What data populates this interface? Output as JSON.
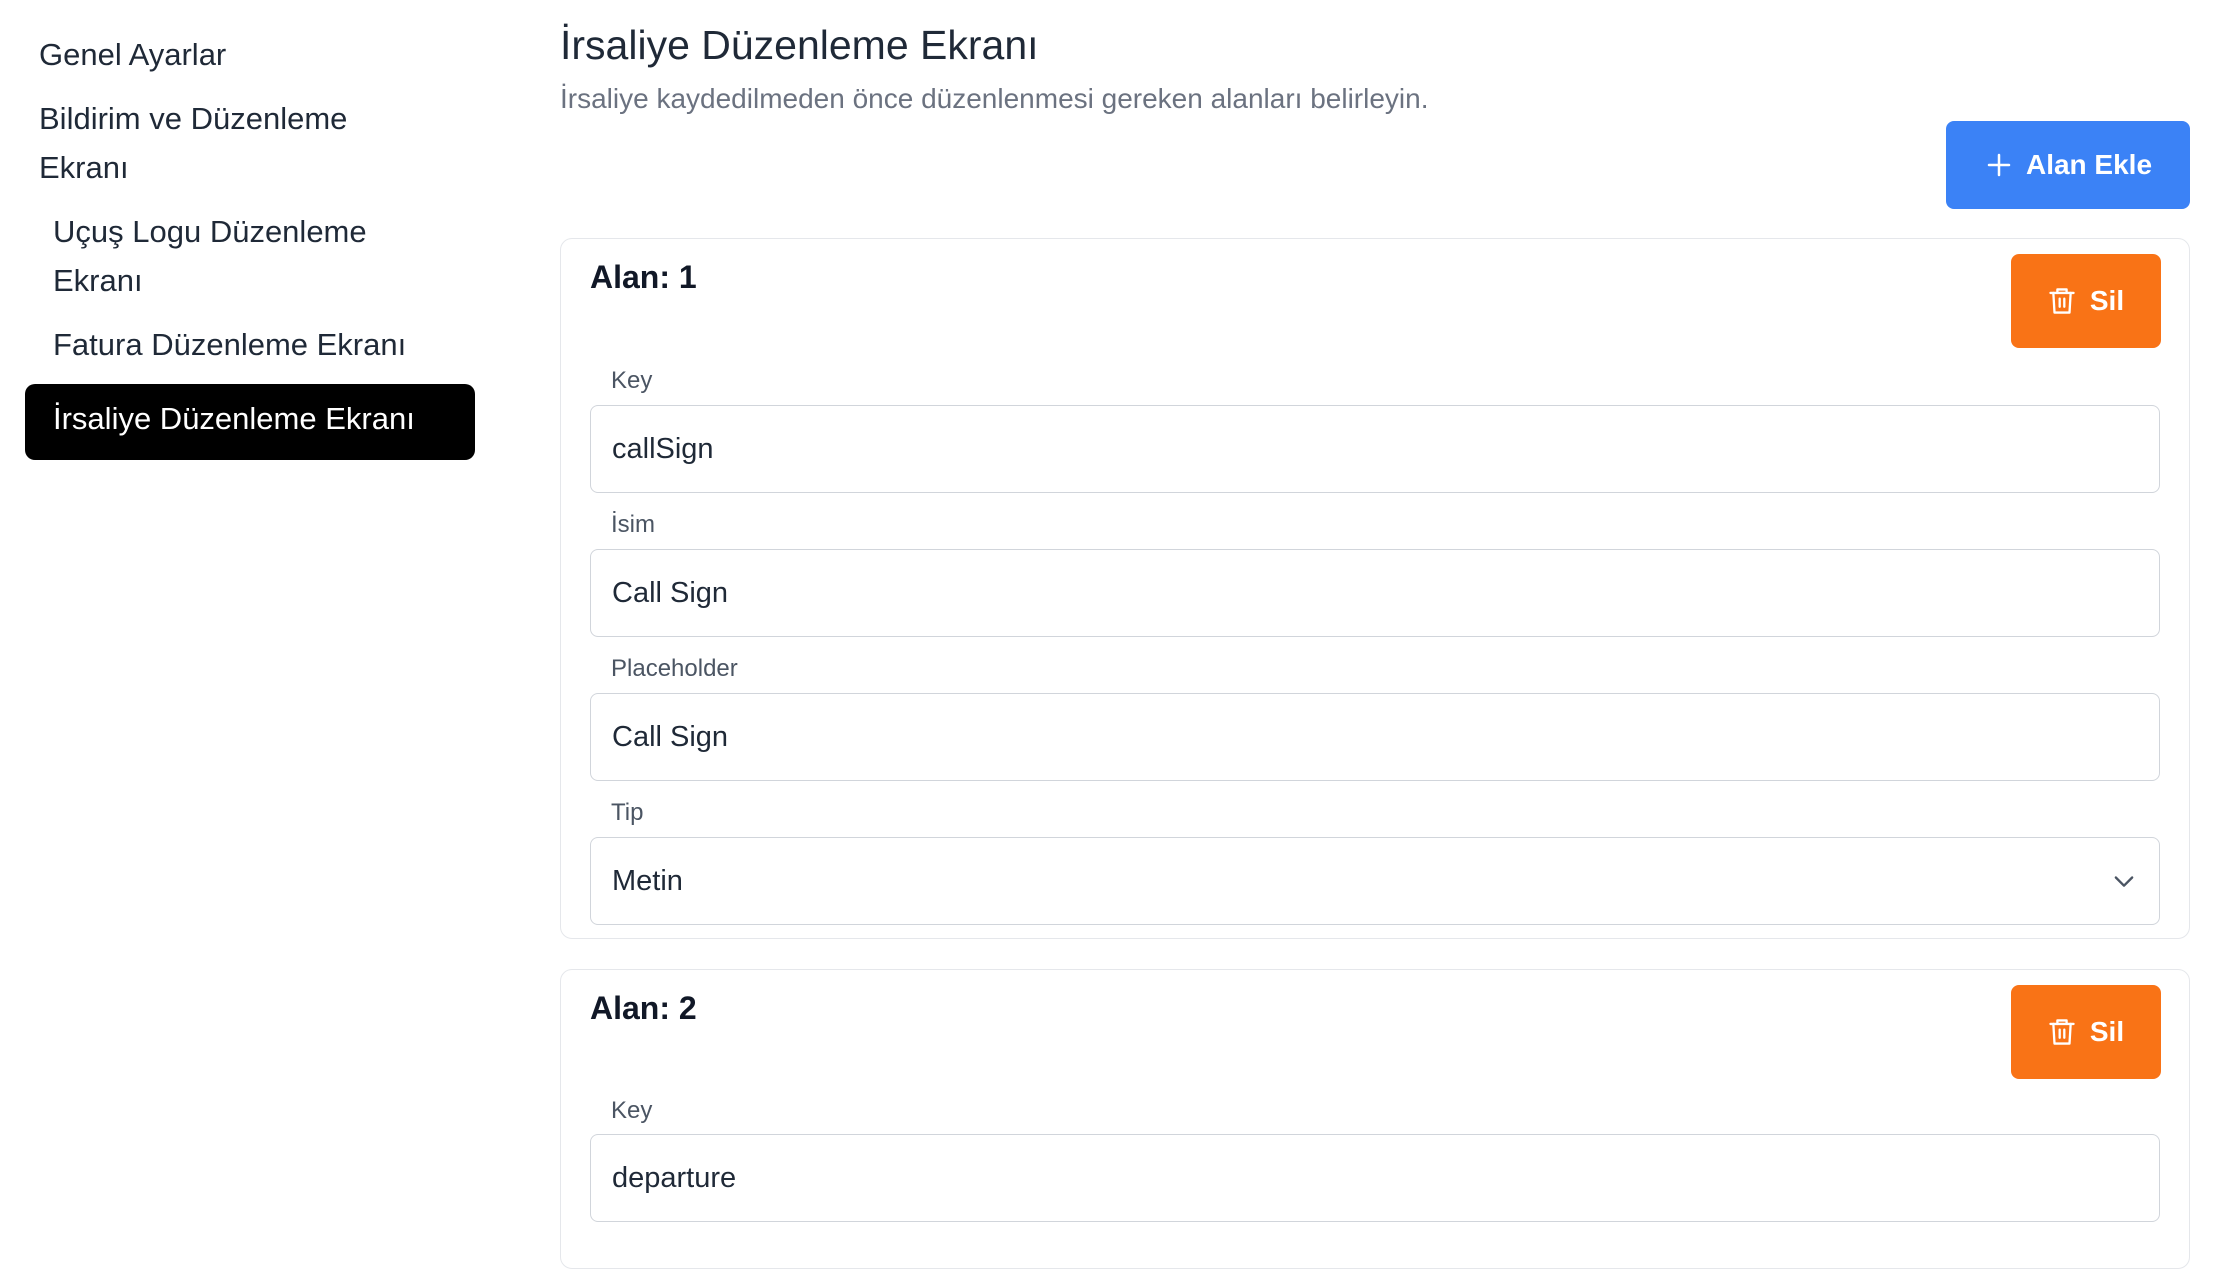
{
  "sidebar": {
    "items": [
      {
        "label": "Genel Ayarlar"
      },
      {
        "label": "Bildirim ve Düzenleme Ekranı"
      },
      {
        "label": "Uçuş Logu Düzenleme Ekranı"
      },
      {
        "label": "Fatura Düzenleme Ekranı"
      },
      {
        "label": "İrsaliye Düzenleme Ekranı",
        "active": true
      }
    ]
  },
  "header": {
    "title": "İrsaliye Düzenleme Ekranı",
    "subtitle": "İrsaliye kaydedilmeden önce düzenlenmesi gereken alanları belirleyin."
  },
  "actions": {
    "add_label": "Alan Ekle",
    "add_icon": "plus-icon",
    "delete_label": "Sil",
    "delete_icon": "trash-icon"
  },
  "colors": {
    "primary": "#3b82f6",
    "danger": "#f97316",
    "active_nav": "#000000"
  },
  "fields": [
    {
      "title": "Alan: 1",
      "key_label": "Key",
      "key_value": "callSign",
      "name_label": "İsim",
      "name_value": "Call Sign",
      "placeholder_label": "Placeholder",
      "placeholder_value": "Call Sign",
      "type_label": "Tip",
      "type_value": "Metin"
    },
    {
      "title": "Alan: 2",
      "key_label": "Key",
      "key_value": "departure"
    }
  ]
}
